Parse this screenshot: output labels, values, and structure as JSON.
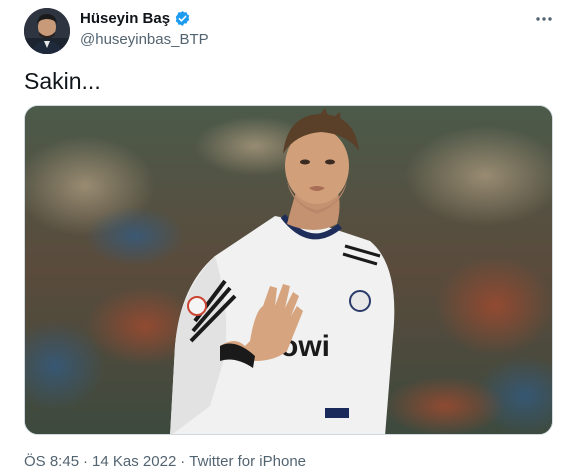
{
  "author": {
    "display_name": "Hüseyin Baş",
    "handle": "@huseyinbas_BTP",
    "verified": true
  },
  "tweet": {
    "text": "Sakin...",
    "time": "ÖS 8:45",
    "dot1": "·",
    "date": "14 Kas 2022",
    "dot2": "·",
    "source": "Twitter for iPhone"
  },
  "icons": {
    "verified": "verified-badge-icon",
    "more": "more-horizontal-icon"
  },
  "colors": {
    "verified_blue": "#1d9bf0",
    "secondary_text": "#536471",
    "primary_text": "#0f1419"
  }
}
